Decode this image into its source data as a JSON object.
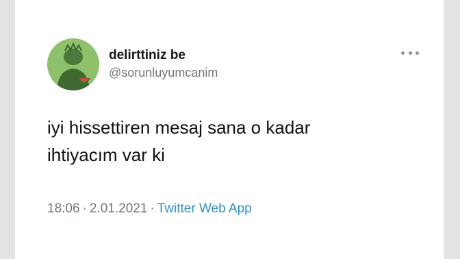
{
  "tweet": {
    "display_name": "delirttiniz be",
    "handle": "@sorunluyumcanim",
    "text_line1": "iyi hissettiren mesaj sana o kadar",
    "text_line2": "ihtiyacım var ki",
    "time": "18:06",
    "separator": "·",
    "date": "2.01.2021",
    "source": "Twitter Web App",
    "more_icon": "more-horizontal-icon",
    "avatar_icon": "avatar-icon",
    "colors": {
      "link": "#2a8fd6",
      "avatar_bg": "#8dc26a",
      "muted": "#6e767d"
    }
  }
}
